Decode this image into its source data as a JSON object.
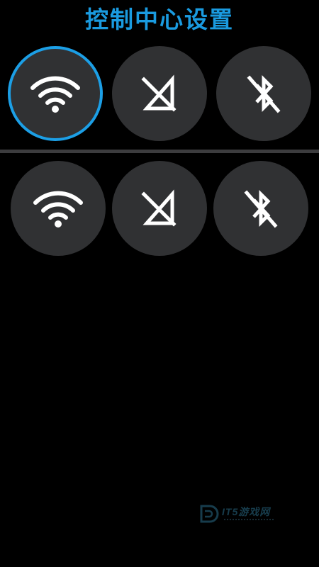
{
  "header": {
    "title": "控制中心设置"
  },
  "rows": [
    {
      "tiles": [
        {
          "name": "wifi",
          "icon": "wifi-icon",
          "selected": true
        },
        {
          "name": "mobile-signal-off",
          "icon": "signal-off-icon",
          "selected": false
        },
        {
          "name": "bluetooth-off",
          "icon": "bluetooth-off-icon",
          "selected": false
        }
      ]
    },
    {
      "tiles": [
        {
          "name": "wifi",
          "icon": "wifi-icon",
          "selected": false
        },
        {
          "name": "mobile-signal-off",
          "icon": "signal-off-icon",
          "selected": false
        },
        {
          "name": "bluetooth-off",
          "icon": "bluetooth-off-icon",
          "selected": false
        }
      ]
    }
  ],
  "watermark": {
    "text": "IT5游戏网"
  },
  "colors": {
    "accent": "#1a9be0",
    "tile_bg": "#303133",
    "background": "#000000",
    "divider": "#3c3c3e"
  }
}
